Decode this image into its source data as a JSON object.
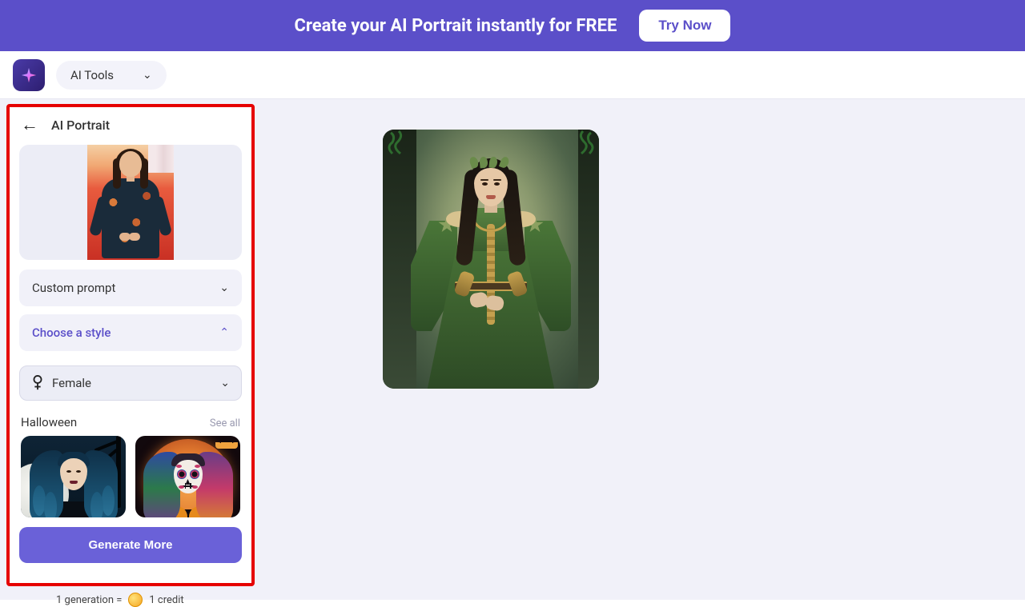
{
  "banner": {
    "text": "Create your AI Portrait instantly for FREE",
    "cta": "Try Now"
  },
  "nav": {
    "tools_label": "AI Tools"
  },
  "sidebar": {
    "title": "AI Portrait",
    "custom_prompt_label": "Custom prompt",
    "choose_style_label": "Choose a style",
    "gender_selected": "Female",
    "category_title": "Halloween",
    "see_all": "See all",
    "generate_label": "Generate More"
  },
  "credits": {
    "prefix": "1 generation =",
    "suffix": "1 credit"
  }
}
